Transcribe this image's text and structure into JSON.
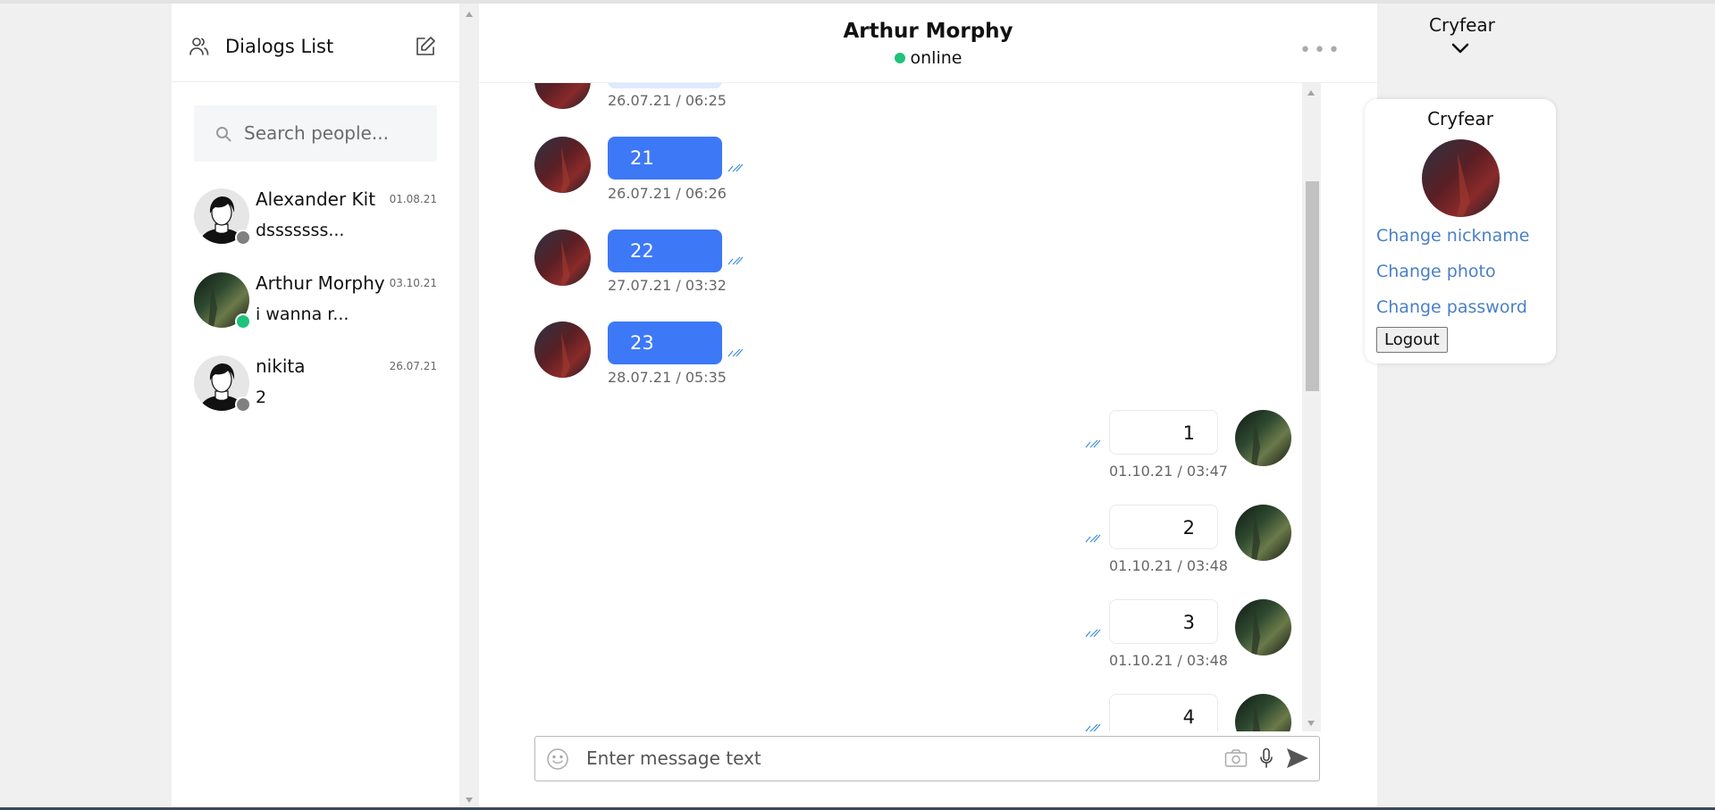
{
  "sidebar": {
    "title": "Dialogs List",
    "search_placeholder": "Search people...",
    "dialogs": [
      {
        "name": "Alexander Kit",
        "date": "01.08.21",
        "preview": "dsssssss...",
        "status": "offline"
      },
      {
        "name": "Arthur Morphy",
        "date": "03.10.21",
        "preview": "i wanna r...",
        "status": "online"
      },
      {
        "name": "nikita",
        "date": "26.07.21",
        "preview": "2",
        "status": "offline"
      }
    ]
  },
  "chat": {
    "title": "Arthur Morphy",
    "status": "online",
    "incoming": [
      {
        "text": "",
        "time": "26.07.21 / 06:25"
      },
      {
        "text": "21",
        "time": "26.07.21 / 06:26"
      },
      {
        "text": "22",
        "time": "27.07.21 / 03:32"
      },
      {
        "text": "23",
        "time": "28.07.21 / 05:35"
      }
    ],
    "outgoing": [
      {
        "text": "1",
        "time": "01.10.21 / 03:47"
      },
      {
        "text": "2",
        "time": "01.10.21 / 03:48"
      },
      {
        "text": "3",
        "time": "01.10.21 / 03:48"
      },
      {
        "text": "4",
        "time": ""
      }
    ],
    "input_placeholder": "Enter message text"
  },
  "account": {
    "username": "Cryfear",
    "menu": {
      "name": "Cryfear",
      "change_nickname": "Change nickname",
      "change_photo": "Change photo",
      "change_password": "Change password",
      "logout": "Logout"
    }
  },
  "colors": {
    "accent": "#3d78f7",
    "online": "#1fc27a",
    "offline": "#808080",
    "link": "#4a7fc7"
  }
}
